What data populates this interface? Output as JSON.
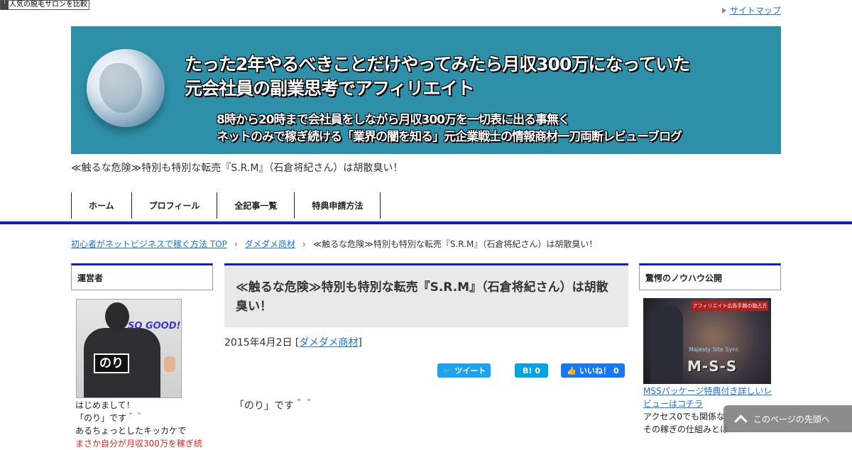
{
  "ad_badge": {
    "label": "人気の脱毛サロンを比較"
  },
  "utility_nav": {
    "sitemap_label": "サイトマップ"
  },
  "header": {
    "banner": {
      "line1": "たった2年やるべきことだけやってみたら月収300万になっていた",
      "line2": "元会社員の副業思考でアフィリエイト",
      "line3": "8時から20時まで会社員をしながら月収300万を一切表に出る事無く",
      "line4": "ネットのみで稼ぎ続ける「業界の闇を知る」元企業戦士の情報商材一刀両断レビューブログ"
    },
    "description": "≪触るな危険≫特別も特別な転売『S.R.M』（石倉将紀さん）は胡散臭い！"
  },
  "global_nav": {
    "items": [
      {
        "label": "ホーム"
      },
      {
        "label": "プロフィール"
      },
      {
        "label": "全記事一覧"
      },
      {
        "label": "特典申請方法"
      }
    ]
  },
  "breadcrumb": {
    "items": [
      {
        "label": "初心者がネットビジネスで稼ぐ方法 TOP"
      },
      {
        "label": "ダメダメ商材"
      }
    ],
    "current": "≪触るな危険≫特別も特別な転売『S.R.M』（石倉将紀さん）は胡散臭い！"
  },
  "sidebar_left": {
    "heading": "運営者",
    "photo": {
      "tag_text": "SO GOOD!",
      "name_plate": "のり"
    },
    "text_lines": [
      "はじめまして！",
      "「のり」です＾＾",
      "あるちょっとしたキッカケで"
    ],
    "highlight_line": "まさか自分が月収300万を稼ぎ続"
  },
  "article": {
    "title": "≪触るな危険≫特別も特別な転売『S.R.M』（石倉将紀さん）は胡散臭い！",
    "date": "2015年4月2日",
    "category": "ダメダメ商材",
    "share": {
      "tweet_label": "ツイート",
      "hatena_label": "B!",
      "hatena_count": "0",
      "like_label": "いいね！",
      "like_count": "0"
    },
    "body_first_line": "「のり」です＾＾"
  },
  "sidebar_right": {
    "heading": "驚愕のノウハウ公開",
    "promo_image": {
      "ribbon_text": "アフィリエイト広告手腕の独占方",
      "subtitle": "Majesty Site Sync",
      "title": "M-S-S"
    },
    "promo_link": "MSSパッケージ特典付き詳しいレビューはコチラ",
    "promo_text_lines": [
      "アクセス0でも関係な",
      "その稼ぎの仕組みとは"
    ]
  },
  "back_to_top": {
    "label": "このページの先頭へ"
  },
  "colors": {
    "accent": "#0d1bd1",
    "banner": "#2e8fa8",
    "link": "#1a73e8",
    "highlight": "#e0261c"
  }
}
